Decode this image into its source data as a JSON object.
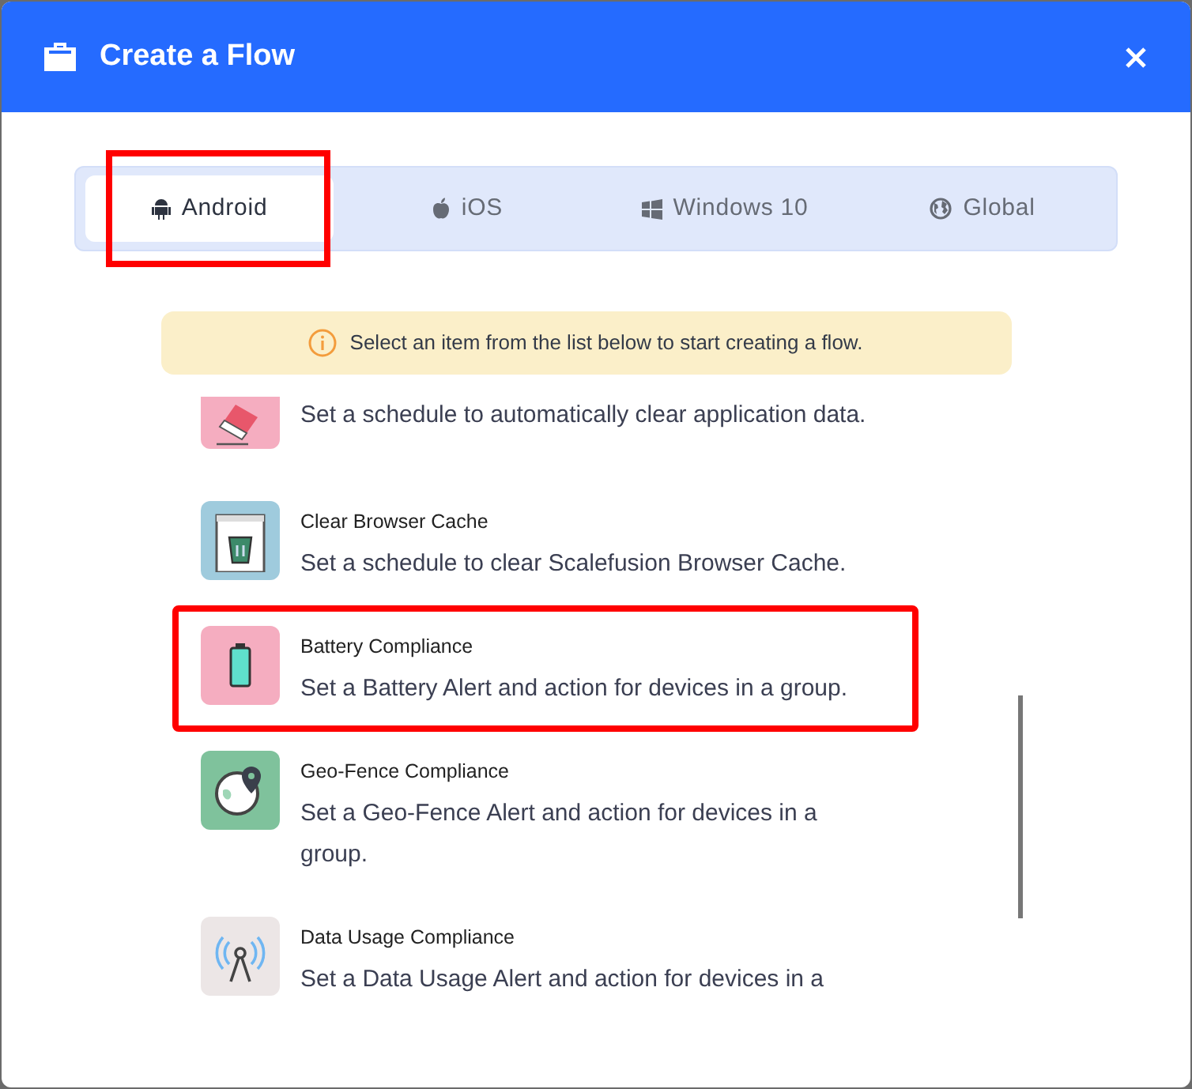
{
  "window": {
    "title": "Create a Flow"
  },
  "tabs": [
    {
      "label": "Android",
      "selected": true,
      "highlighted": true
    },
    {
      "label": "iOS",
      "selected": false,
      "highlighted": false
    },
    {
      "label": "Windows 10",
      "selected": false,
      "highlighted": false
    },
    {
      "label": "Global",
      "selected": false,
      "highlighted": false
    }
  ],
  "notice": "Select an item from the list below to start creating a flow.",
  "items": [
    {
      "description": "Set a schedule to automatically clear application data.",
      "highlighted": false
    },
    {
      "title": "Clear Browser Cache",
      "description": "Set a schedule to clear Scalefusion Browser Cache.",
      "highlighted": false
    },
    {
      "title": "Battery Compliance",
      "description": "Set a Battery Alert and action for devices in a group.",
      "highlighted": true
    },
    {
      "title": "Geo-Fence Compliance",
      "description": "Set a Geo-Fence Alert and action for devices in a group.",
      "highlighted": false
    },
    {
      "title": "Data Usage Compliance",
      "description": "Set a Data Usage Alert and action for devices in a",
      "highlighted": false
    }
  ]
}
